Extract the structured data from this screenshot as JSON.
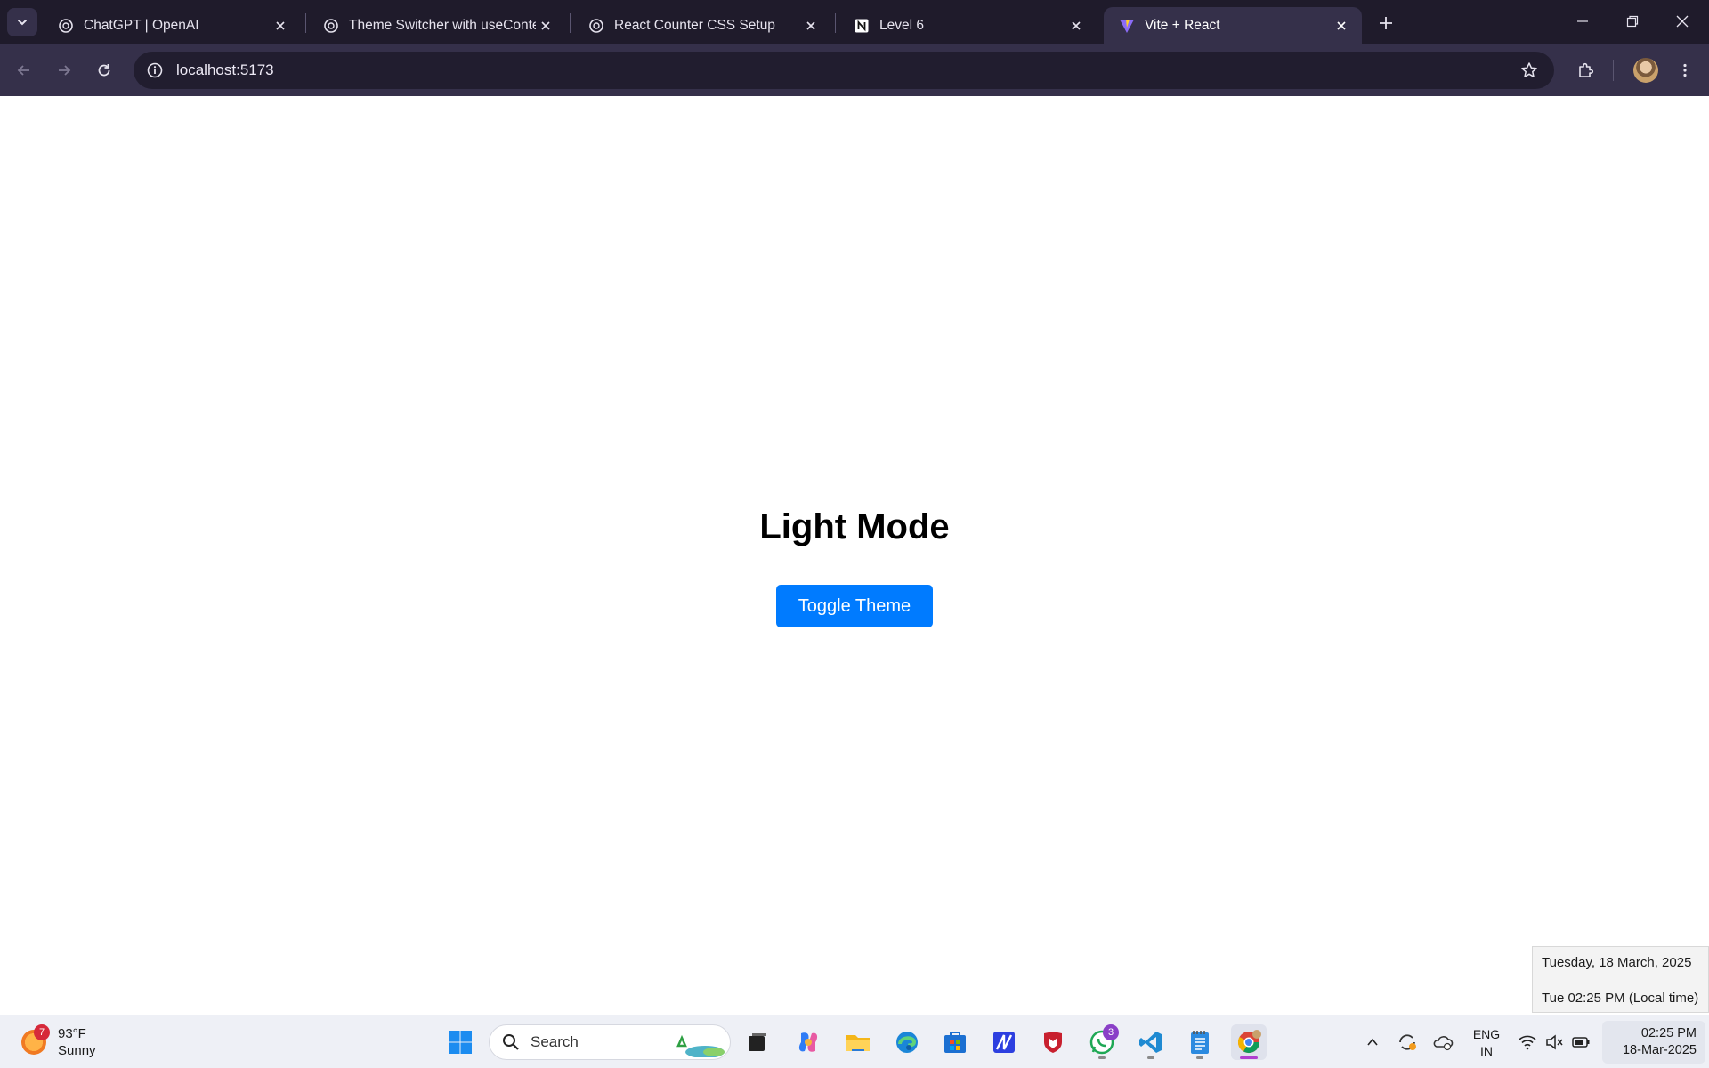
{
  "browser": {
    "tabs": [
      {
        "title": "ChatGPT | OpenAI",
        "icon": "openai-icon"
      },
      {
        "title": "Theme Switcher with useContext",
        "icon": "openai-icon"
      },
      {
        "title": "React Counter CSS Setup",
        "icon": "openai-icon"
      },
      {
        "title": "Level 6",
        "icon": "notion-icon"
      },
      {
        "title": "Vite + React",
        "icon": "vite-icon",
        "active": true
      }
    ],
    "url": "localhost:5173"
  },
  "page": {
    "heading": "Light Mode",
    "toggle_button": "Toggle Theme",
    "button_color": "#007bff"
  },
  "clock_flyout": {
    "date_line": "Tuesday, 18 March, 2025",
    "time_line": "Tue 02:25 PM (Local time)"
  },
  "taskbar": {
    "weather": {
      "badge": "7",
      "temperature": "93°F",
      "condition": "Sunny"
    },
    "search_label": "Search",
    "whatsapp_badge": "3",
    "language": {
      "line1": "ENG",
      "line2": "IN"
    },
    "clock": {
      "time": "02:25 PM",
      "date": "18-Mar-2025"
    }
  },
  "colors": {
    "tabstrip": "#1f1b2b",
    "toolbar": "#35304a",
    "accent": "#007bff"
  }
}
